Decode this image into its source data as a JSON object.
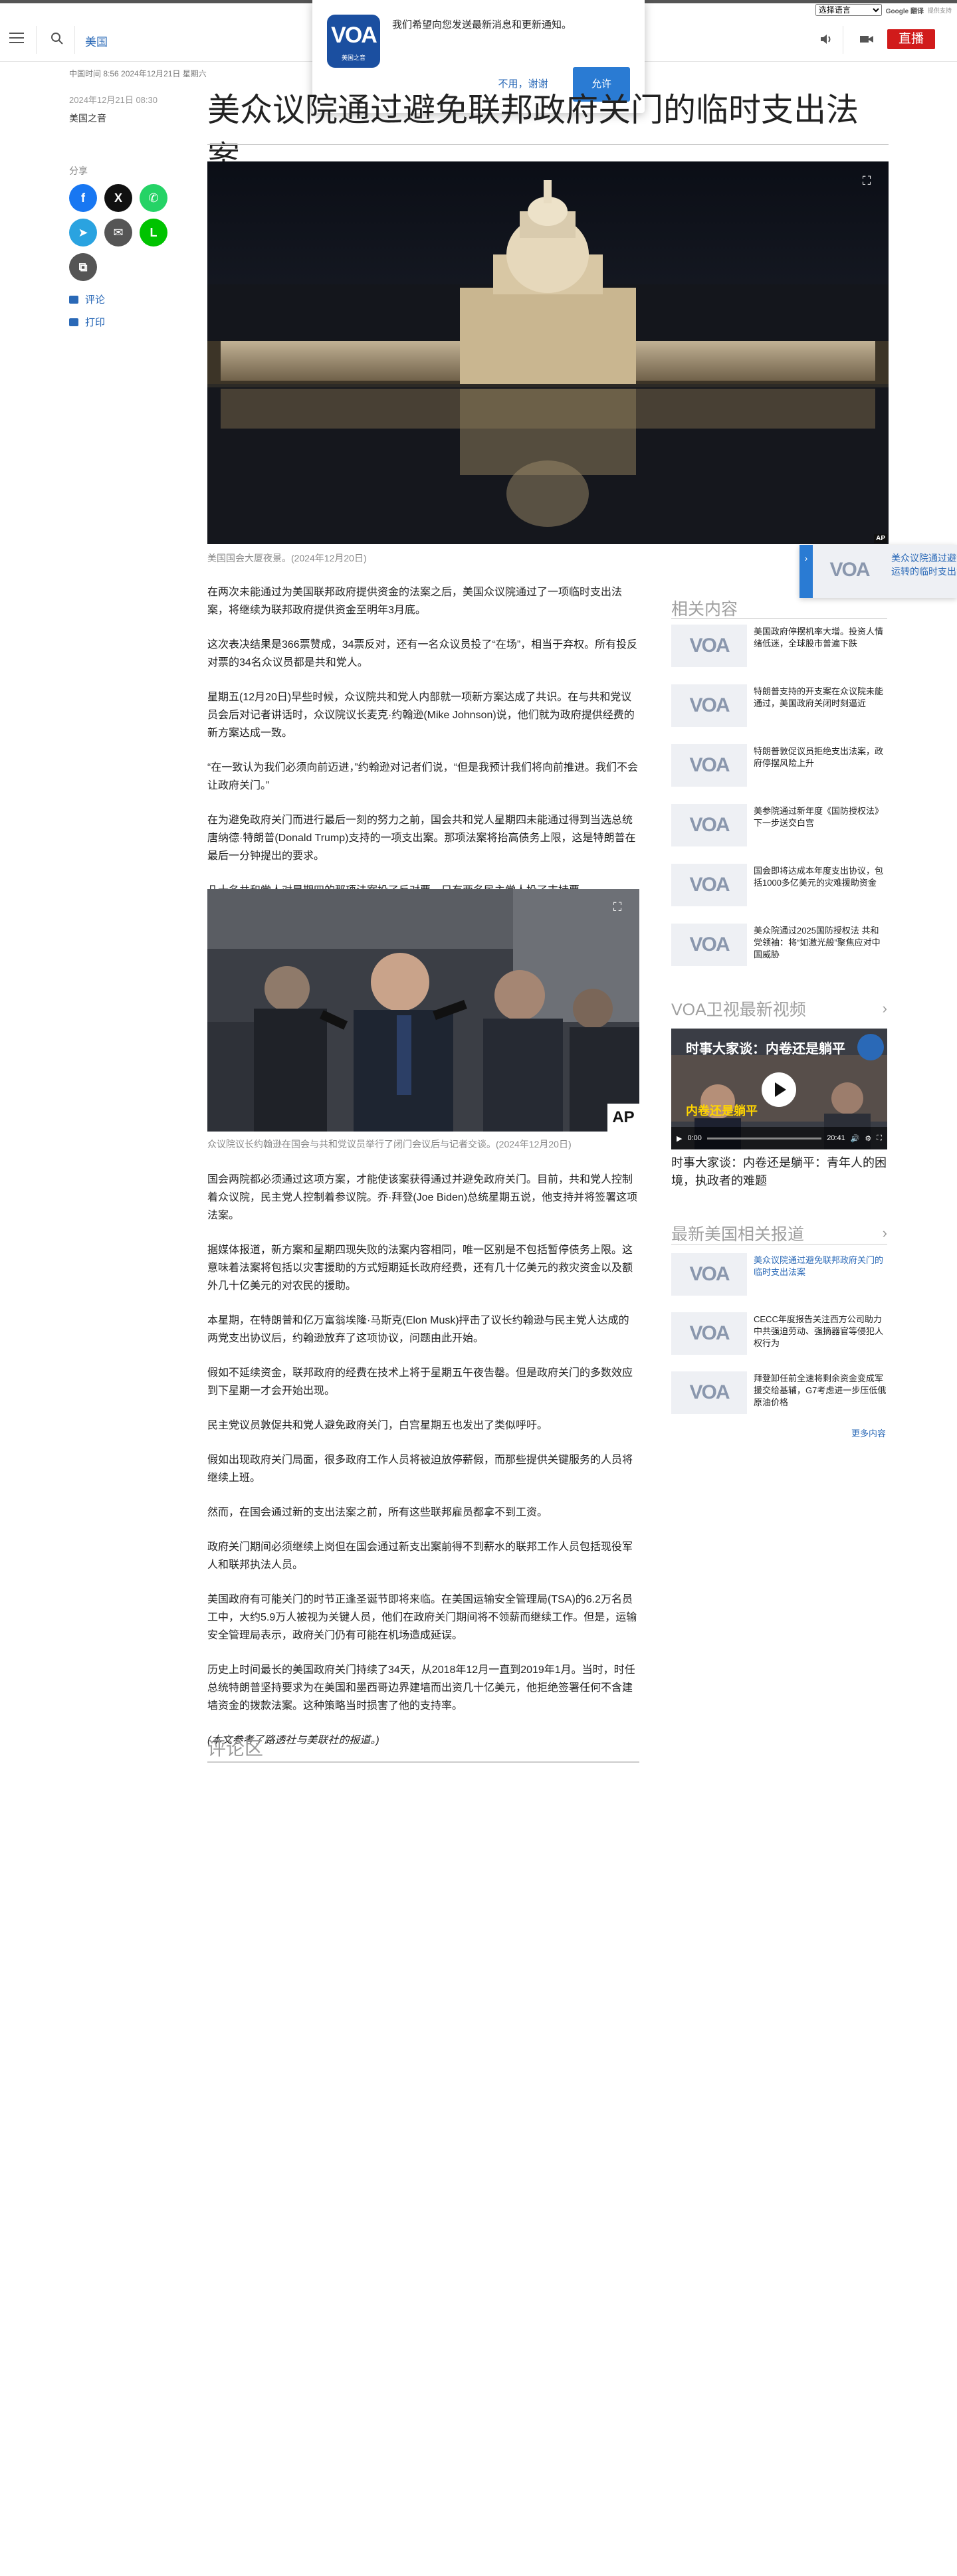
{
  "translate": {
    "select_value": "选择语言",
    "powered_by": "提供支持",
    "google_translate": "Google 翻译"
  },
  "nav": {
    "section": "美国",
    "live_label": "直播",
    "live_color": "#d11b1b",
    "link_color": "#2a69b7"
  },
  "notification": {
    "logo_text": "VOA",
    "logo_subtext": "美国之音",
    "message": "我们希望向您发送最新消息和更新通知。",
    "deny_label": "不用，谢谢",
    "allow_label": "允许"
  },
  "article": {
    "dateline": "中国时间 8:56 2024年12月21日 星期六",
    "published": "2024年12月21日 08:30",
    "author": "美国之音",
    "headline": "美众议院通过避免联邦政府关门的临时支出法案",
    "share_label": "分享",
    "share_buttons": [
      {
        "name": "facebook",
        "glyph": "f",
        "color": "#1877f2"
      },
      {
        "name": "x",
        "glyph": "X",
        "color": "#111111"
      },
      {
        "name": "whatsapp",
        "glyph": "✆",
        "color": "#25d366"
      },
      {
        "name": "telegram",
        "glyph": "➤",
        "color": "#2aa3e0"
      },
      {
        "name": "email",
        "glyph": "✉",
        "color": "#555555"
      },
      {
        "name": "line",
        "glyph": "L",
        "color": "#00c300"
      },
      {
        "name": "copy",
        "glyph": "⧉",
        "color": "#555555"
      }
    ],
    "comments_link": "评论",
    "print_link": "打印",
    "hero_caption": "美国国会大厦夜景。(2024年12月20日)",
    "photo2_caption": "众议院议长约翰逊在国会与共和党议员举行了闭门会议后与记者交谈。(2024年12月20日)",
    "hero_credit": "AP",
    "photo2_credit": "AP",
    "paragraphs_a": [
      "在两次未能通过为美国联邦政府提供资金的法案之后，美国众议院通过了一项临时支出法案，将继续为联邦政府提供资金至明年3月底。",
      "这次表决结果是366票赞成，34票反对，还有一名众议员投了“在场”，相当于弃权。所有投反对票的34名众议员都是共和党人。",
      "星期五(12月20日)早些时候，众议院共和党人内部就一项新方案达成了共识。在与共和党议员会后对记者讲话时，众议院议长麦克·约翰逊(Mike Johnson)说，他们就为政府提供经费的新方案达成一致。",
      "“在一致认为我们必须向前迈进，”约翰逊对记者们说，“但是我预计我们将向前推进。我们不会让政府关门。”",
      "在为避免政府关门而进行最后一刻的努力之前，国会共和党人星期四未能通过得到当选总统唐纳德·特朗普(Donald Trump)支持的一项支出案。那项法案将抬高债务上限，这是特朗普在最后一分钟提出的要求。",
      "几十名共和党人对星期四的那项法案投了反对票，只有两名民主党人投了支持票。"
    ],
    "paragraphs_b": [
      "国会两院都必须通过这项方案，才能使该案获得通过并避免政府关门。目前，共和党人控制着众议院，民主党人控制着参议院。乔·拜登(Joe Biden)总统星期五说，他支持并将签署这项法案。",
      "据媒体报道，新方案和星期四现失败的法案内容相同，唯一区别是不包括暂停债务上限。这意味着法案将包括以灾害援助的方式短期延长政府经费，还有几十亿美元的救灾资金以及额外几十亿美元的对农民的援助。",
      "本星期，在特朗普和亿万富翁埃隆·马斯克(Elon Musk)抨击了议长约翰逊与民主党人达成的两党支出协议后，约翰逊放弃了这项协议，问题由此开始。",
      "假如不延续资金，联邦政府的经费在技术上将于星期五午夜告罄。但是政府关门的多数效应到下星期一才会开始出现。",
      "民主党议员敦促共和党人避免政府关门，白宫星期五也发出了类似呼吁。",
      "假如出现政府关门局面，很多政府工作人员将被迫放停薪假，而那些提供关键服务的人员将继续上班。",
      "然而，在国会通过新的支出法案之前，所有这些联邦雇员都拿不到工资。",
      "政府关门期间必须继续上岗但在国会通过新支出案前得不到薪水的联邦工作人员包括现役军人和联邦执法人员。",
      "美国政府有可能关门的时节正逢圣诞节即将来临。在美国运输安全管理局(TSA)的6.2万名员工中，大约5.9万人被视为关键人员，他们在政府关门期间将不领薪而继续工作。但是，运输安全管理局表示，政府关门仍有可能在机场造成延误。",
      "历史上时间最长的美国政府关门持续了34天，从2018年12月一直到2019年1月。当时，时任总统特朗普坚持要求为在美国和墨西哥边界建墙而出资几十亿美元，他拒绝签署任何不含建墙资金的拨款法案。这种策略当时损害了他的支持率。"
    ],
    "note": "(本文参考了路透社与美联社的报道。)",
    "comments_heading": "评论区"
  },
  "related": {
    "heading": "相关内容",
    "thumb_logo": "VOA",
    "items": [
      {
        "text": "美国政府停摆机率大增。投资人情绪低迷，全球股市普遍下跌"
      },
      {
        "text": "特朗普支持的开支案在众议院未能通过，美国政府关闭时刻逼近"
      },
      {
        "text": "特朗普敦促议员拒绝支出法案，政府停摆风险上升"
      },
      {
        "text": "美参院通过新年度《国防授权法》 下一步送交白宫"
      },
      {
        "text": "国会即将达成本年度支出协议，包括1000多亿美元的灾难援助资金"
      },
      {
        "text": "美众院通过2025国防授权法 共和党领袖：将“如激光般”聚焦应对中国威胁"
      }
    ]
  },
  "video": {
    "heading": "VOA卫视最新视频",
    "overlay_title": "时事大家谈：内卷还是躺平",
    "overlay_sub": "内卷还是躺平",
    "time_current": "0:00",
    "time_total": "20:41",
    "caption": "时事大家谈：内卷还是躺平：青年人的困境，执政者的难题"
  },
  "latest": {
    "heading": "最新美国相关报道",
    "items": [
      {
        "text": "美众议院通过避免联邦政府关门的临时支出法案",
        "active": true
      },
      {
        "text": "CECC年度报告关注西方公司助力中共强迫劳动、强摘器官等侵犯人权行为",
        "active": false
      },
      {
        "text": "拜登卸任前全速将剩余资金变成军援交给基辅，G7考虑进一步压低俄原油价格",
        "active": false
      }
    ],
    "more_label": "更多内容"
  },
  "sticky": {
    "text_line1": "美众议院通过避免联邦政",
    "text_line2": "运转的临时支出法案"
  }
}
